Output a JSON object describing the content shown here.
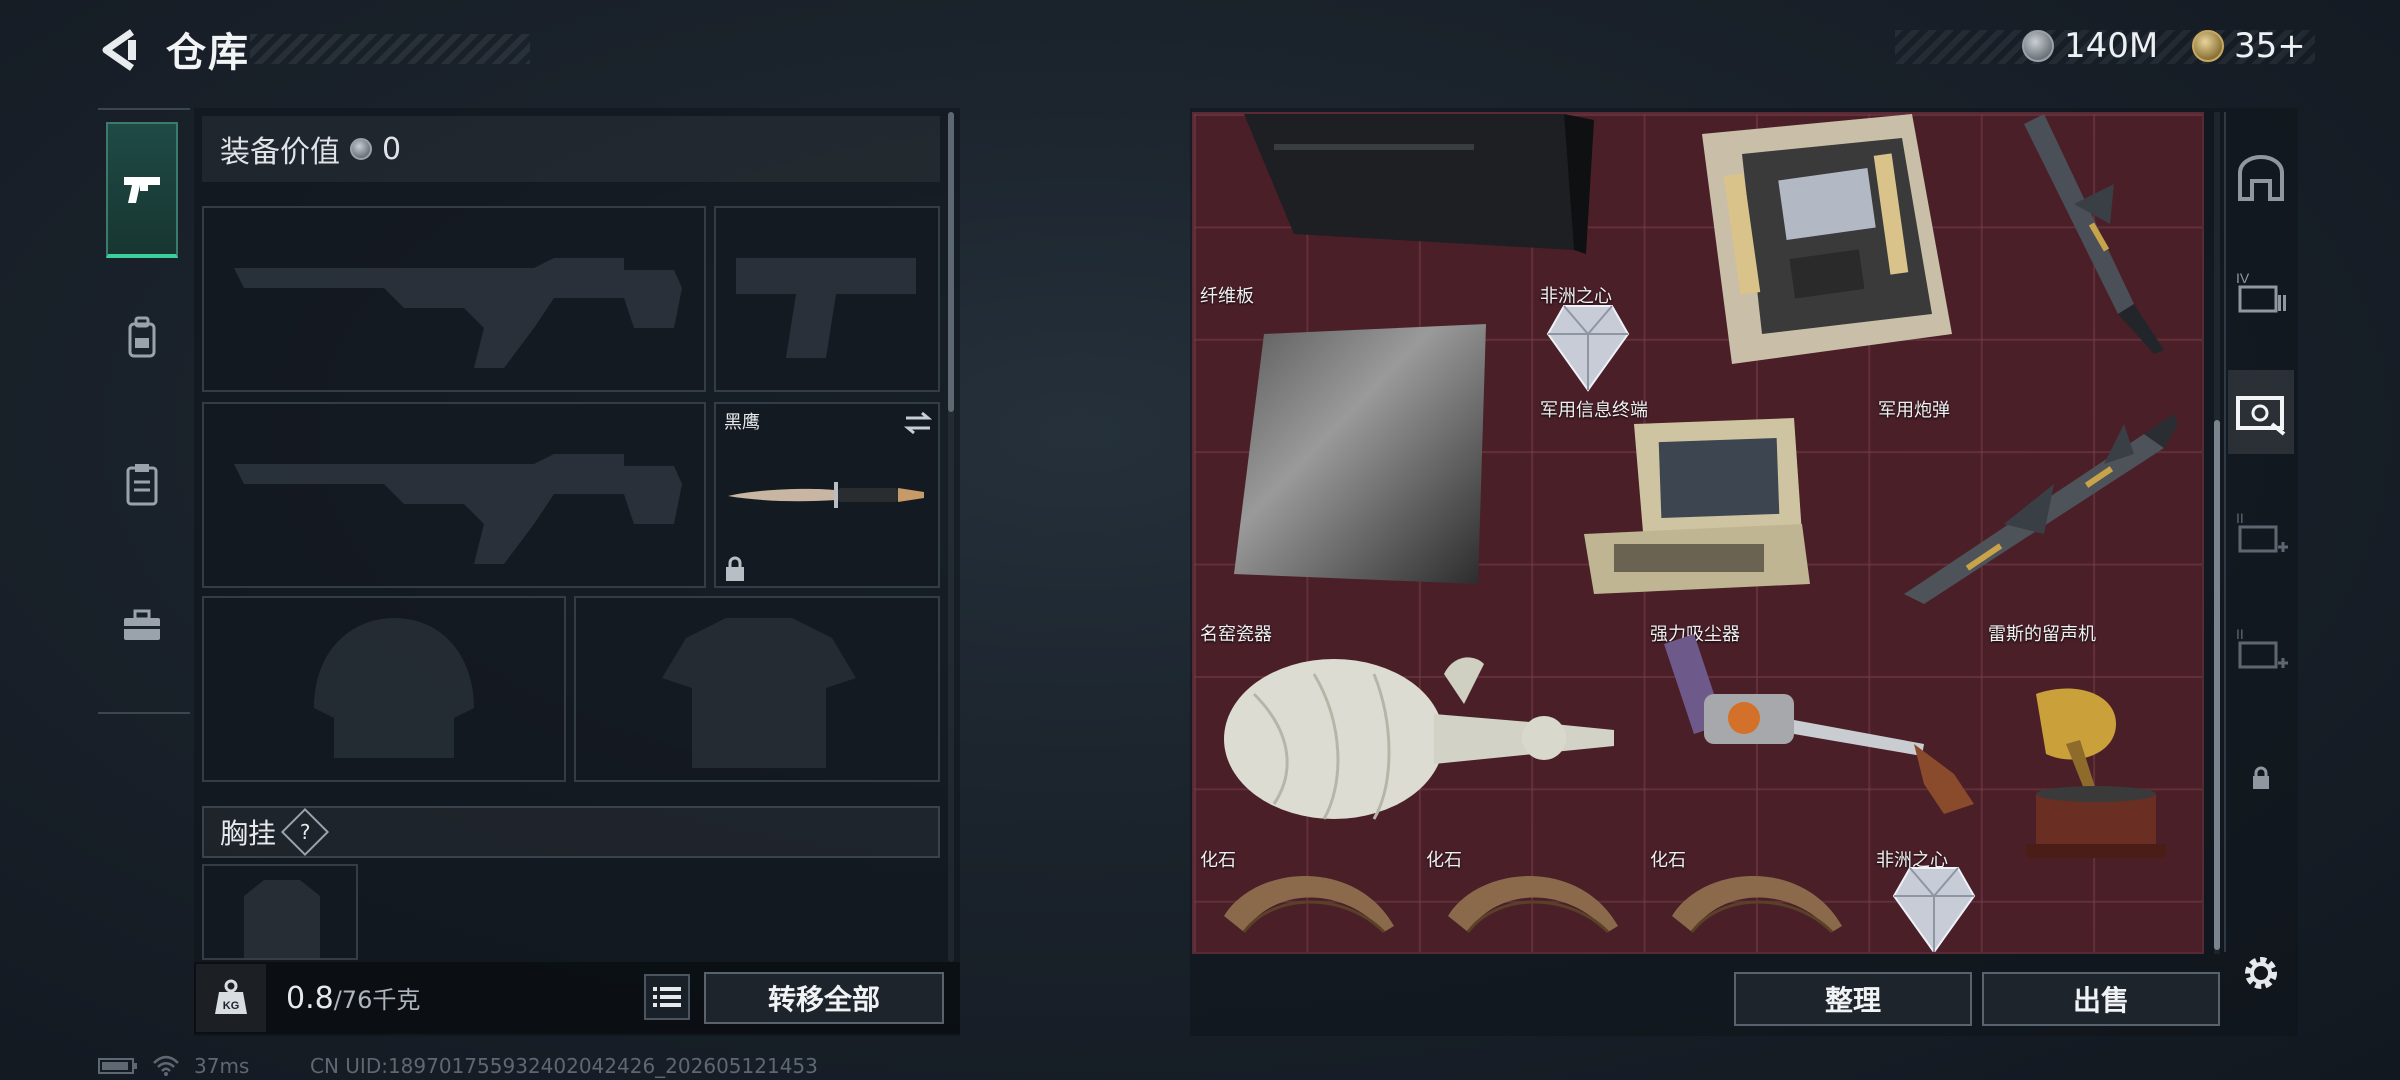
{
  "header": {
    "title": "仓库",
    "currencies": [
      {
        "icon": "silver-coin-icon",
        "value": "140M"
      },
      {
        "icon": "gold-ticket-icon",
        "value": "35+"
      }
    ]
  },
  "left_nav": {
    "items": [
      {
        "icon": "pistol-icon",
        "active": true
      },
      {
        "icon": "backpack-icon",
        "active": false
      },
      {
        "icon": "clipboard-icon",
        "active": false
      },
      {
        "icon": "toolbox-icon",
        "active": false
      }
    ]
  },
  "loadout": {
    "equip_value_label": "装备价值",
    "equip_value": "0",
    "slots": {
      "primary_weapon_1": "",
      "pistol": "",
      "primary_weapon_2": "",
      "melee": {
        "name": "黑鹰",
        "locked": true
      },
      "helmet": "",
      "armor": ""
    },
    "chest_rig_label": "胸挂",
    "chest_rig_help": "?",
    "weight_current": "0.8",
    "weight_max": "/76千克",
    "weight_icon_text": "KG",
    "transfer_all_label": "转移全部"
  },
  "inventory": {
    "items": [
      {
        "name": "纤维板"
      },
      {
        "name": "非洲之心"
      },
      {
        "name": "军用信息终端"
      },
      {
        "name": "军用炮弹"
      },
      {
        "name": "名窑瓷器"
      },
      {
        "name": "强力吸尘器"
      },
      {
        "name": "雷斯的留声机"
      },
      {
        "name": "化石"
      },
      {
        "name": "化石"
      },
      {
        "name": "化石"
      },
      {
        "name": "非洲之心"
      }
    ],
    "arrange_label": "整理",
    "sell_label": "出售"
  },
  "right_col": {
    "buttons": [
      {
        "icon": "safe-box-icon"
      },
      {
        "icon": "storage-iv-icon",
        "label": "IV"
      },
      {
        "icon": "storage-cases-icon",
        "active": true
      },
      {
        "icon": "add-storage-ii-icon",
        "label": "II"
      },
      {
        "icon": "add-storage-ii-icon",
        "label": "II"
      },
      {
        "icon": "lock-icon"
      }
    ]
  },
  "status": {
    "ping": "37ms",
    "uid": "CN UID:189701755932402042426_202605121453"
  },
  "colors": {
    "grid_bg": "#4a1f28",
    "accent_green": "#3bcf9b",
    "panel_bg": "#0f141a"
  }
}
